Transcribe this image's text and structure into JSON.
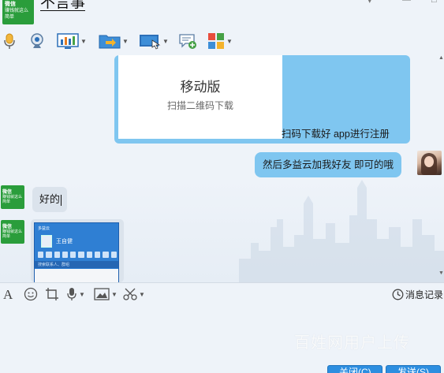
{
  "header": {
    "contact_name": "不言事",
    "avatar_line1": "微信",
    "avatar_line2": "赚钱就这么简单"
  },
  "toolbar": {
    "items": [
      "voice-call-icon",
      "video-call-icon",
      "screen-share-icon",
      "file-transfer-icon",
      "remote-desktop-icon",
      "new-chat-icon",
      "apps-icon"
    ]
  },
  "chat": {
    "card": {
      "title": "移动版",
      "subtitle": "扫描二维码下载",
      "caption": "扫码下载好  app进行注册"
    },
    "msg_right": "然后多益云加我好友  即可的哦",
    "msg_left": "好的",
    "left_avatar_line1": "微信",
    "left_avatar_line2": "赚钱就这么简单",
    "screenshot": {
      "title": "多益云",
      "name": "王自健",
      "search": "搜索联系人、群组"
    }
  },
  "input_toolbar": {
    "history_label": "消息记录"
  },
  "watermark": "百姓网用户上传",
  "buttons": {
    "close": "关闭(C)",
    "send": "发送(S)"
  },
  "colors": {
    "accent": "#2d8ee0",
    "bubble_blue": "#7fc6f0",
    "wechat_green": "#2a9d3b"
  }
}
